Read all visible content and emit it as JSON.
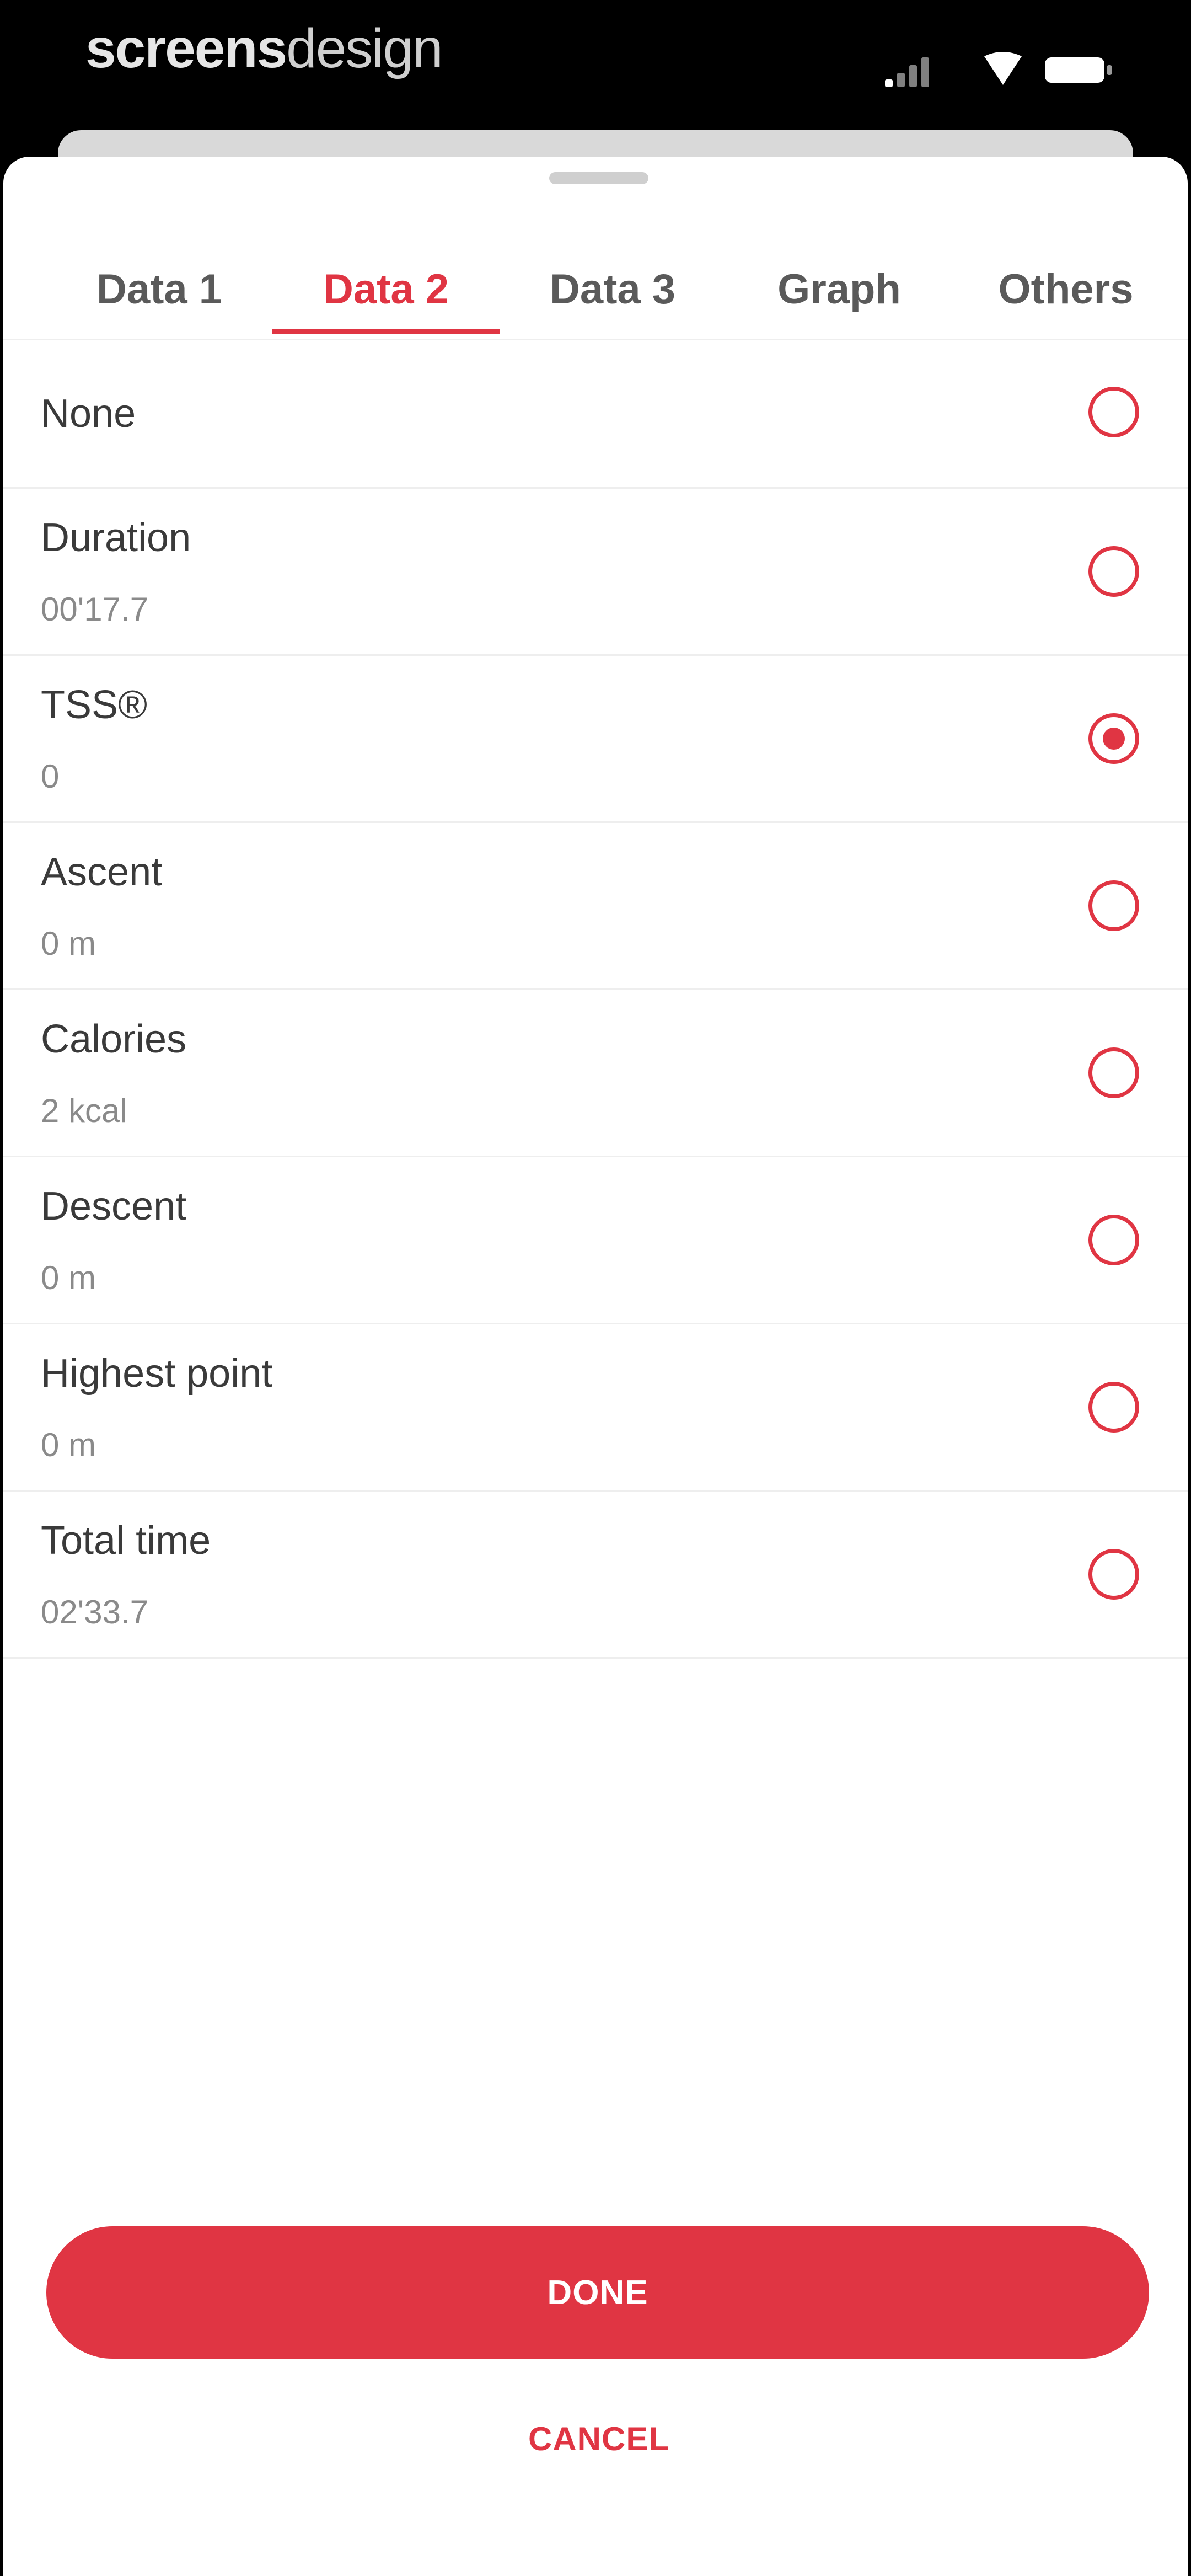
{
  "status_bar": {
    "brand_bold": "screens",
    "brand_light": "design",
    "icons": [
      "signal-icon",
      "wifi-icon",
      "battery-icon"
    ]
  },
  "tabs": [
    {
      "label": "Data 1",
      "active": false
    },
    {
      "label": "Data 2",
      "active": true
    },
    {
      "label": "Data 3",
      "active": false
    },
    {
      "label": "Graph",
      "active": false
    },
    {
      "label": "Others",
      "active": false
    }
  ],
  "options": [
    {
      "label": "None",
      "value": "",
      "selected": false
    },
    {
      "label": "Duration",
      "value": "00'17.7",
      "selected": false
    },
    {
      "label": "TSS®",
      "value": "0",
      "selected": true
    },
    {
      "label": "Ascent",
      "value": "0 m",
      "selected": false
    },
    {
      "label": "Calories",
      "value": "2 kcal",
      "selected": false
    },
    {
      "label": "Descent",
      "value": "0 m",
      "selected": false
    },
    {
      "label": "Highest point",
      "value": "0 m",
      "selected": false
    },
    {
      "label": "Total time",
      "value": "02'33.7",
      "selected": false
    }
  ],
  "actions": {
    "done_label": "DONE",
    "cancel_label": "CANCEL"
  },
  "colors": {
    "accent": "#e03543",
    "text": "#3a3a3a",
    "subtext": "#8a8a8a",
    "divider": "#eeeeee"
  }
}
